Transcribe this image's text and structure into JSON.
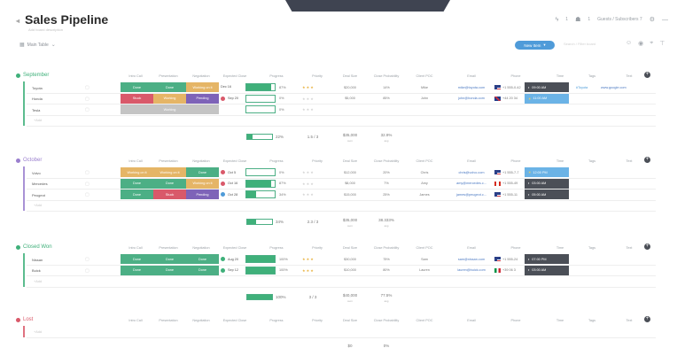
{
  "header": {
    "title": "Sales Pipeline",
    "subtitle": "Add board description",
    "right_a": "1",
    "right_b": "1",
    "right_c": "Guests / Subscribers  7"
  },
  "toolbar": {
    "table_label": "Main Table",
    "new_item_label": "New Item",
    "search_placeholder": "Search / Filter board"
  },
  "columns": [
    "Intro Call",
    "Presentation",
    "Negotiation",
    "Expected Close",
    "Progress",
    "Priority",
    "Deal Size",
    "Close Probability",
    "Client POC",
    "Email",
    "Phone",
    "Time",
    "Tags",
    "Text"
  ],
  "colors": {
    "done": "#4caf85",
    "stuck": "#d9596a",
    "pending": "#7e63b8",
    "working": "#e5b566",
    "grey": "#c4c4c4",
    "blue": "#4f9bd9"
  },
  "groups": [
    {
      "title": "September",
      "color": "#3fb07a",
      "rows": [
        {
          "name": "Toyota",
          "s1": "Done",
          "s1c": "done",
          "s2": "Done",
          "s2c": "done",
          "s3": "Working on it",
          "s3c": "working",
          "date": "Dec 16",
          "ring": "",
          "progress": 87,
          "pct": "87%",
          "stars": 3,
          "deal": "$20,000",
          "prob": "14%",
          "poc": "Mike",
          "email": "mike@toyota.com",
          "flag": "us",
          "phone": "+1 555-0-42",
          "time": "09:00 AM",
          "timec": "dark",
          "tag": "#Toyota",
          "text": "www.google.com"
        },
        {
          "name": "Honda",
          "s1": "Stuck",
          "s1c": "stuck",
          "s2": "Working",
          "s2c": "working",
          "s3": "Pending",
          "s3c": "pending",
          "date": "Sep 20",
          "ring": "#d9596a",
          "progress": 0,
          "pct": "0%",
          "stars": 0,
          "deal": "$5,000",
          "prob": "85%",
          "poc": "John",
          "email": "john@honda.com",
          "flag": "uk",
          "phone": "+44 20 34",
          "time": "11:00 AM",
          "timec": "light",
          "tag": "",
          "text": ""
        },
        {
          "name": "Tesla",
          "s1": "",
          "s1c": "grey",
          "s2": "Working",
          "s2c": "grey",
          "s3": "",
          "s3c": "grey",
          "date": "",
          "ring": "",
          "progress": 0,
          "pct": "0%",
          "stars": 0,
          "deal": "",
          "prob": "",
          "poc": "",
          "email": "",
          "flag": "",
          "phone": "",
          "time": "",
          "timec": "",
          "tag": "",
          "text": ""
        }
      ],
      "add": "+Add",
      "summary": {
        "progress": 22,
        "pct": "22%",
        "rating": "1.5 / 3",
        "deal": "$35,000",
        "deal_sub": "sum",
        "prob": "32.9%",
        "prob_sub": "avg"
      }
    },
    {
      "title": "October",
      "color": "#9a7fce",
      "rows": [
        {
          "name": "Volvo",
          "s1": "Working on it",
          "s1c": "working",
          "s2": "Working on it",
          "s2c": "working",
          "s3": "Done",
          "s3c": "done",
          "date": "Oct 5",
          "ring": "#d9596a",
          "progress": 0,
          "pct": "0%",
          "stars": 0,
          "deal": "$12,000",
          "prob": "20%",
          "poc": "Chris",
          "email": "chris@volvo.com",
          "flag": "us",
          "phone": "+1 555-7-7",
          "time": "12:00 PM",
          "timec": "light",
          "tag": "",
          "text": ""
        },
        {
          "name": "Mercedes",
          "s1": "Done",
          "s1c": "done",
          "s2": "Done",
          "s2c": "done",
          "s3": "Working on it",
          "s3c": "working",
          "date": "Oct 16",
          "ring": "#d9596a",
          "progress": 87,
          "pct": "87%",
          "stars": 0,
          "deal": "$8,000",
          "prob": "7%",
          "poc": "Amy",
          "email": "amy@mercedes.c...",
          "flag": "ca",
          "phone": "+1 555-49",
          "time": "03:00 AM",
          "timec": "dark",
          "tag": "",
          "text": ""
        },
        {
          "name": "Peugeot",
          "s1": "Done",
          "s1c": "done",
          "s2": "Stuck",
          "s2c": "stuck",
          "s3": "Pending",
          "s3c": "pending",
          "date": "Oct 28",
          "ring": "#4f9bd9",
          "progress": 34,
          "pct": "34%",
          "stars": 0,
          "deal": "$15,000",
          "prob": "25%",
          "poc": "James",
          "email": "james@peugeot.c...",
          "flag": "us",
          "phone": "+1 555-11",
          "time": "05:00 AM",
          "timec": "dark",
          "tag": "",
          "text": ""
        }
      ],
      "add": "+Add",
      "summary": {
        "progress": 34,
        "pct": "34%",
        "rating": "2.3 / 3",
        "deal": "$35,000",
        "deal_sub": "sum",
        "prob": "38.333%",
        "prob_sub": "avg"
      }
    },
    {
      "title": "Closed Won",
      "color": "#3fb07a",
      "rows": [
        {
          "name": "Nissan",
          "s1": "Done",
          "s1c": "done",
          "s2": "Done",
          "s2c": "done",
          "s3": "Done",
          "s3c": "done",
          "date": "Aug 20",
          "ring": "#3fb07a",
          "progress": 100,
          "pct": "100%",
          "stars": 3,
          "deal": "$30,000",
          "prob": "75%",
          "poc": "Sam",
          "email": "sam@nissan.com",
          "flag": "us",
          "phone": "+1 555-24",
          "time": "07:00 PM",
          "timec": "dark",
          "tag": "",
          "text": ""
        },
        {
          "name": "Buick",
          "s1": "Done",
          "s1c": "done",
          "s2": "Done",
          "s2c": "done",
          "s3": "Done",
          "s3c": "done",
          "date": "Sep 12",
          "ring": "#3fb07a",
          "progress": 100,
          "pct": "100%",
          "stars": 3,
          "deal": "$10,000",
          "prob": "80%",
          "poc": "Lauren",
          "email": "lauren@buick.com",
          "flag": "it",
          "phone": "+39 06 3",
          "time": "03:00 AM",
          "timec": "dark",
          "tag": "",
          "text": ""
        }
      ],
      "add": "+Add",
      "summary": {
        "progress": 100,
        "pct": "100%",
        "rating": "3 / 3",
        "deal": "$40,000",
        "deal_sub": "sum",
        "prob": "77.5%",
        "prob_sub": "avg"
      }
    },
    {
      "title": "Lost",
      "color": "#d9596a",
      "rows": [],
      "add": "+Add",
      "summary": {
        "progress": 0,
        "pct": "",
        "rating": "",
        "deal": "$0",
        "deal_sub": "",
        "prob": "0%",
        "prob_sub": ""
      }
    }
  ]
}
